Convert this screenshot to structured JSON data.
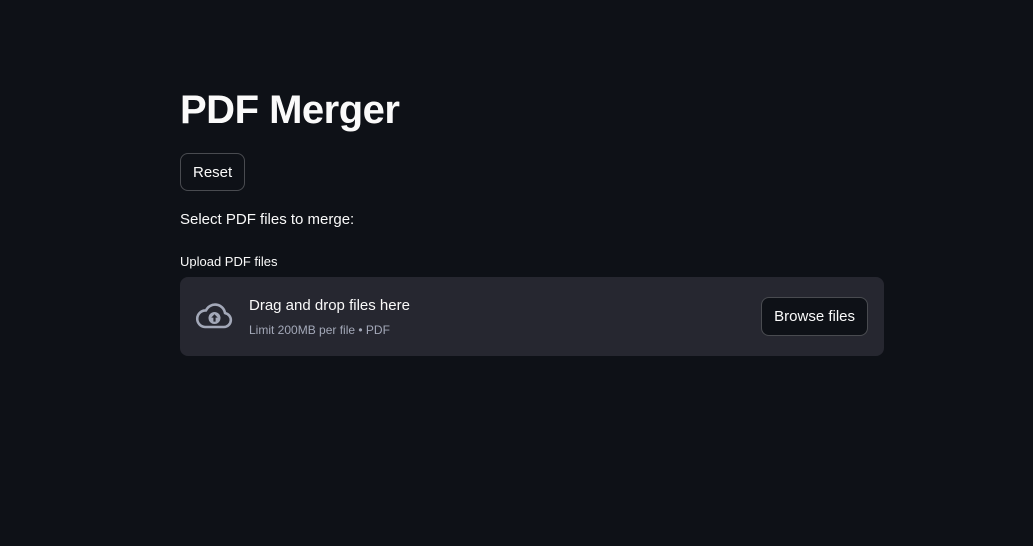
{
  "page": {
    "title": "PDF Merger",
    "reset_label": "Reset",
    "instructions": "Select PDF files to merge:"
  },
  "uploader": {
    "label": "Upload PDF files",
    "drop_text": "Drag and drop files here",
    "limit_text": "Limit 200MB per file • PDF",
    "browse_label": "Browse files",
    "icon": "cloud-upload-icon"
  },
  "colors": {
    "background": "#0e1117",
    "dropzone": "#262730",
    "text": "#fafafa",
    "muted_text": "#a3a8b8"
  }
}
